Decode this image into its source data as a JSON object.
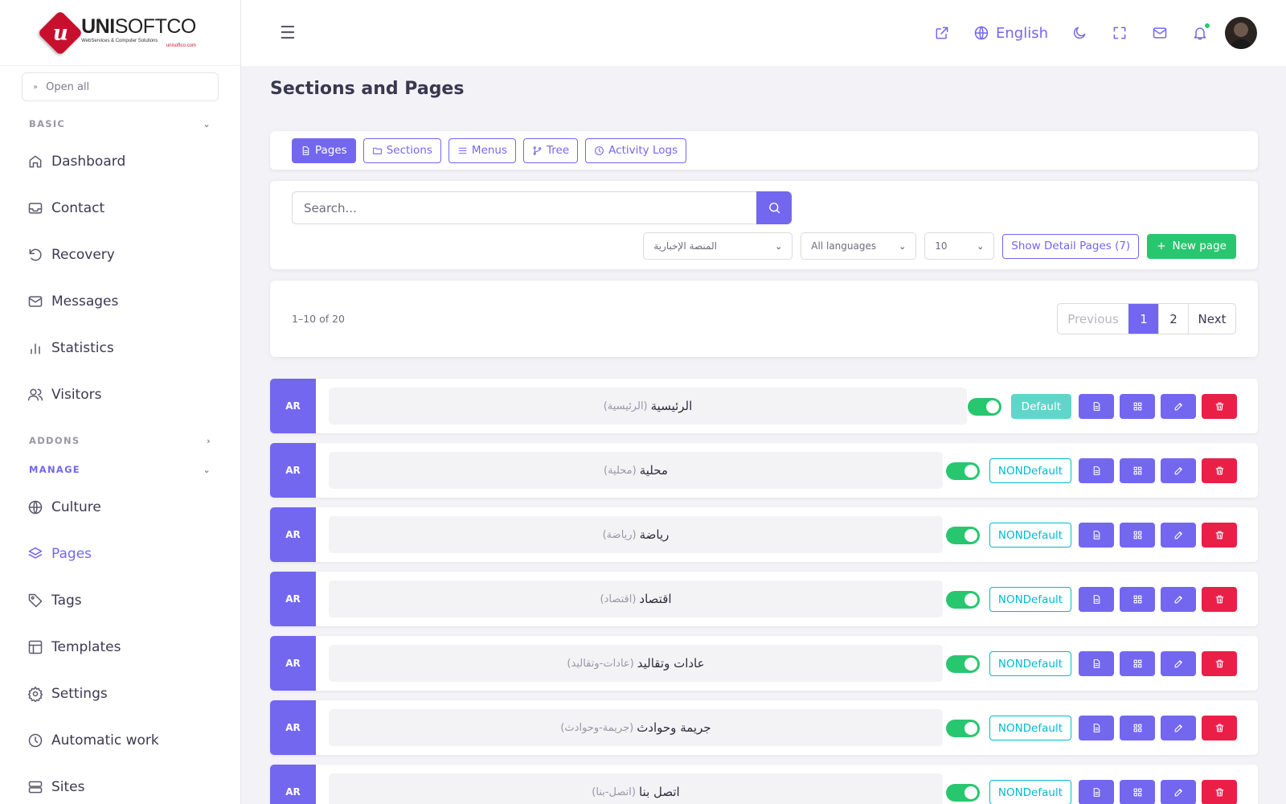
{
  "brand": {
    "name_bold": "UNI",
    "name_light": "SOFTCO",
    "tagline": "WebServices & Computer Solutions",
    "url": "unisoftco.com",
    "mark": "u"
  },
  "sidebar": {
    "open_all": "Open all",
    "groups": {
      "basic": "BASIC",
      "addons": "ADDONS",
      "manage": "MANAGE"
    },
    "basic_items": [
      {
        "label": "Dashboard",
        "icon": "home-icon"
      },
      {
        "label": "Contact",
        "icon": "inbox-icon"
      },
      {
        "label": "Recovery",
        "icon": "rotate-icon"
      },
      {
        "label": "Messages",
        "icon": "mail-icon"
      },
      {
        "label": "Statistics",
        "icon": "chart-icon"
      },
      {
        "label": "Visitors",
        "icon": "users-icon"
      }
    ],
    "manage_items": [
      {
        "label": "Culture",
        "icon": "globe-icon"
      },
      {
        "label": "Pages",
        "icon": "layers-icon",
        "active": true
      },
      {
        "label": "Tags",
        "icon": "tag-icon"
      },
      {
        "label": "Templates",
        "icon": "layout-icon"
      },
      {
        "label": "Settings",
        "icon": "gear-icon"
      },
      {
        "label": "Automatic work",
        "icon": "clock-icon"
      },
      {
        "label": "Sites",
        "icon": "server-icon"
      }
    ]
  },
  "topbar": {
    "language": "English"
  },
  "main": {
    "title": "Sections and Pages",
    "tabs": [
      {
        "label": "Pages",
        "icon": "file-icon",
        "active": true
      },
      {
        "label": "Sections",
        "icon": "folder-icon"
      },
      {
        "label": "Menus",
        "icon": "menu-icon"
      },
      {
        "label": "Tree",
        "icon": "branch-icon"
      },
      {
        "label": "Activity Logs",
        "icon": "clock-icon"
      }
    ],
    "search": {
      "placeholder": "Search..."
    },
    "filters": {
      "site": "المنصة الإخبارية",
      "language": "All languages",
      "per_page": "10",
      "detail_button": "Show Detail Pages (7)",
      "new_button": "New page"
    },
    "count": "1–10 of 20",
    "pagination": {
      "previous": "Previous",
      "pages": [
        "1",
        "2"
      ],
      "current": "1",
      "next": "Next"
    },
    "rows": [
      {
        "lang": "AR",
        "title": "الرئيسية",
        "slug": "(الرئيسية)",
        "status": "Default",
        "enabled": true
      },
      {
        "lang": "AR",
        "title": "محلية",
        "slug": "(محلية)",
        "status": "NONDefault",
        "enabled": true
      },
      {
        "lang": "AR",
        "title": "رياضة",
        "slug": "(رياضة)",
        "status": "NONDefault",
        "enabled": true
      },
      {
        "lang": "AR",
        "title": "اقتصاد",
        "slug": "(اقتصاد)",
        "status": "NONDefault",
        "enabled": true
      },
      {
        "lang": "AR",
        "title": "عادات وتقاليد",
        "slug": "(عادات-وتقاليد)",
        "status": "NONDefault",
        "enabled": true
      },
      {
        "lang": "AR",
        "title": "جريمة وحوادث",
        "slug": "(جريمة-وحوادث)",
        "status": "NONDefault",
        "enabled": true
      },
      {
        "lang": "AR",
        "title": "اتصل بنا",
        "slug": "(اتصل-بنا)",
        "status": "NONDefault",
        "enabled": true
      }
    ]
  },
  "colors": {
    "primary": "#7367f0",
    "success": "#28c76f",
    "danger": "#ea1f48",
    "info": "#00bad1"
  }
}
